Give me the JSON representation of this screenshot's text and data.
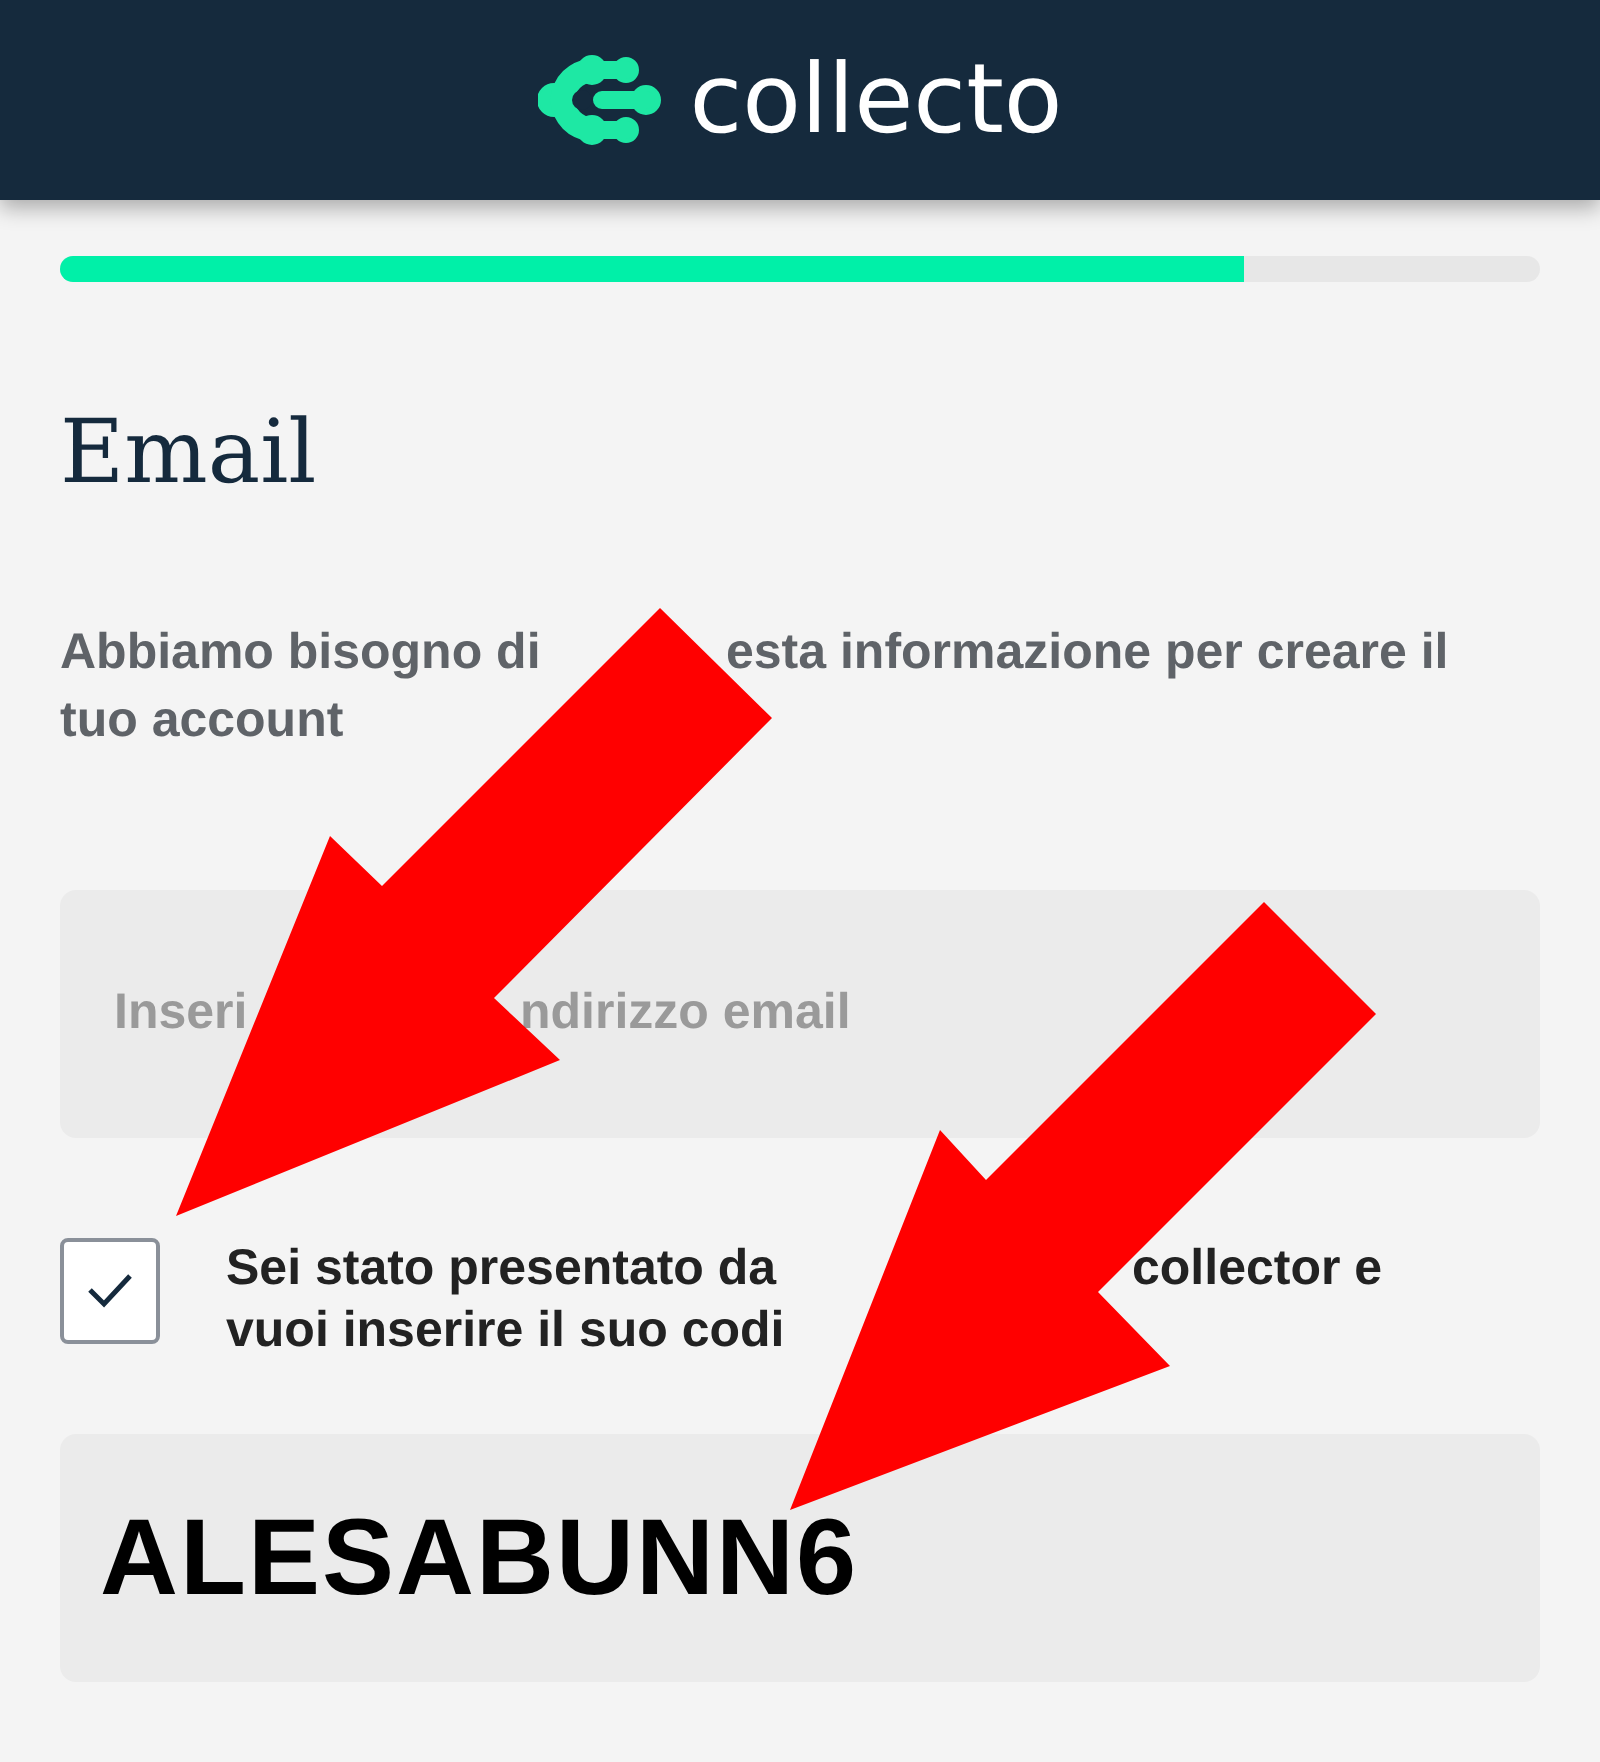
{
  "header": {
    "logo_text": "collecto"
  },
  "progress": {
    "level": 0.8
  },
  "title": "Email",
  "description": {
    "lines": [
      [
        "Abbiamo bisogno di",
        "esta informazione per creare il"
      ],
      [
        "tuo account"
      ]
    ]
  },
  "email_field": {
    "placeholder_parts": [
      "Inseri",
      "ndirizzo email"
    ]
  },
  "referral": {
    "checked": true,
    "lines": [
      [
        "Sei stato presentato da",
        "collector e"
      ],
      [
        "vuoi inserire il suo codi"
      ]
    ]
  },
  "code_field": {
    "value": "ALESABUNN6"
  },
  "annotations": [
    {
      "kind": "arrow"
    },
    {
      "kind": "arrow"
    }
  ]
}
